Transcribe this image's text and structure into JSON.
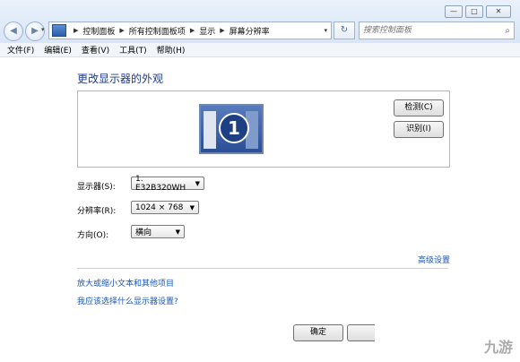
{
  "window": {
    "minimize": "—",
    "maximize": "□",
    "close": "✕"
  },
  "nav": {
    "back": "◀",
    "forward": "▶",
    "recent": "▾"
  },
  "address": {
    "crumbs": [
      "控制面板",
      "所有控制面板项",
      "显示",
      "屏幕分辨率"
    ],
    "sep": "▶",
    "dropdown": "▾",
    "refresh": "↻"
  },
  "search": {
    "placeholder": "搜索控制面板",
    "icon": "⌕"
  },
  "menu": [
    "文件(F)",
    "编辑(E)",
    "查看(V)",
    "工具(T)",
    "帮助(H)"
  ],
  "page": {
    "title": "更改显示器的外观",
    "monitor_number": "1",
    "detect_label": "检测(C)",
    "identify_label": "识别(I)"
  },
  "settings": {
    "display": {
      "label": "显示器(S):",
      "value": "1. E32B320WH"
    },
    "resolution": {
      "label": "分辨率(R):",
      "value": "1024 × 768"
    },
    "orientation": {
      "label": "方向(O):",
      "value": "横向"
    },
    "dropdown_arrow": "▼"
  },
  "links": {
    "advanced": "高级设置",
    "text_size": "放大或缩小文本和其他项目",
    "which_settings": "我应该选择什么显示器设置?"
  },
  "footer": {
    "ok": "确定"
  },
  "watermark": "九游"
}
